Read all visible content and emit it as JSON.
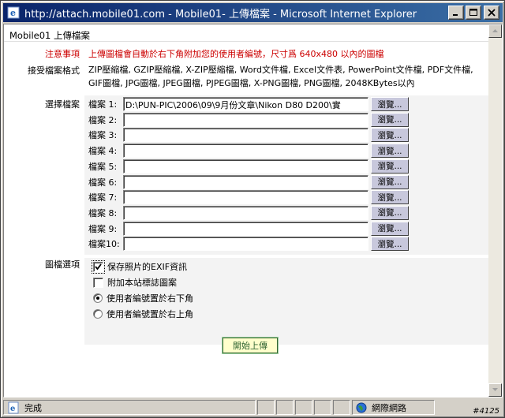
{
  "window": {
    "title": "http://attach.mobile01.com - Mobile01- 上傳檔案 - Microsoft Internet Explorer"
  },
  "page": {
    "header": "Mobile01 上傳檔案",
    "notice_label": "注意事項",
    "notice_text": "上傳圖檔會自動於右下角附加您的使用者編號，尺寸爲 640x480 以內的圖檔",
    "formats_label": "接受檔案格式",
    "formats_text": "ZIP壓縮檔, GZIP壓縮檔, X-ZIP壓縮檔, Word文件檔, Excel文件表, PowerPoint文件檔, PDF文件檔, GIF圖檔, JPG圖檔, JPEG圖檔, PJPEG圖檔, X-PNG圖檔, PNG圖檔, 2048KBytes以內",
    "select_label": "選擇檔案",
    "browse_label": "瀏覽...",
    "files": [
      {
        "label": "檔案 1:",
        "value": "D:\\PUN-PIC\\2006\\09\\9月份文章\\Nikon D80 D200\\實"
      },
      {
        "label": "檔案 2:",
        "value": ""
      },
      {
        "label": "檔案 3:",
        "value": ""
      },
      {
        "label": "檔案 4:",
        "value": ""
      },
      {
        "label": "檔案 5:",
        "value": ""
      },
      {
        "label": "檔案 6:",
        "value": ""
      },
      {
        "label": "檔案 7:",
        "value": ""
      },
      {
        "label": "檔案 8:",
        "value": ""
      },
      {
        "label": "檔案 9:",
        "value": ""
      },
      {
        "label": "檔案10:",
        "value": ""
      }
    ],
    "image_options_label": "圖檔選項",
    "options": {
      "keep_exif": {
        "label": "保存照片的EXIF資訊",
        "checked": true
      },
      "add_logo": {
        "label": "附加本站標誌圖案",
        "checked": false
      },
      "id_bottom_right": {
        "label": "使用者編號置於右下角",
        "selected": true
      },
      "id_top_right": {
        "label": "使用者編號置於右上角",
        "selected": false
      }
    },
    "submit_label": "開始上傳"
  },
  "statusbar": {
    "status": "完成",
    "zone": "網際網路"
  },
  "watermark": "#4125",
  "colors": {
    "title_gradient_start": "#0a246a",
    "title_gradient_end": "#3a6ea5",
    "notice": "#cc0000",
    "submit_border": "#336633",
    "submit_bg": "#ffffcc"
  }
}
